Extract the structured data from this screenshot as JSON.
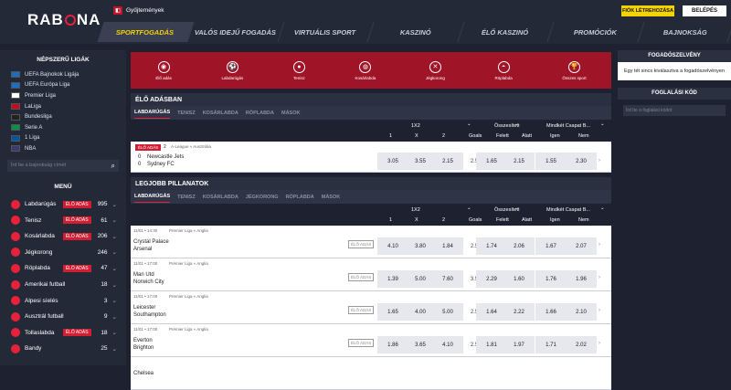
{
  "header": {
    "logo": "RABONA",
    "collections": "Gyűjtemények",
    "register": "FIÓK LÉTREHOZÁSA",
    "login": "BELÉPÉS",
    "nav": [
      "SPORTFOGADÁS",
      "VALÓS IDEJŰ FOGADÁS",
      "VIRTUÁLIS SPORT",
      "KASZINÓ",
      "ÉLŐ KASZINÓ",
      "PROMÓCIÓK",
      "BAJNOKSÁG"
    ]
  },
  "sidebar": {
    "popular_title": "NÉPSZERŰ LIGÁK",
    "leagues": [
      {
        "name": "UEFA Bajnokok Ligája",
        "flag": "#1a6fc4"
      },
      {
        "name": "UEFA Európa Liga",
        "flag": "#1a6fc4"
      },
      {
        "name": "Premier Liga",
        "flag": "#ffffff"
      },
      {
        "name": "LaLiga",
        "flag": "#c60b1e"
      },
      {
        "name": "Bundesliga",
        "flag": "#222222"
      },
      {
        "name": "Serie A",
        "flag": "#009246"
      },
      {
        "name": "1 Liga",
        "flag": "#0055a4"
      },
      {
        "name": "NBA",
        "flag": "#3c3b6e"
      }
    ],
    "search_placeholder": "Írd be a bajnokság címét",
    "menu_title": "MENÜ",
    "live_badge": "ÉLŐ ADÁS",
    "menu": [
      {
        "label": "Labdarúgás",
        "live": true,
        "count": "995"
      },
      {
        "label": "Tenisz",
        "live": true,
        "count": "61"
      },
      {
        "label": "Kosárlabda",
        "live": true,
        "count": "206"
      },
      {
        "label": "Jégkorong",
        "live": false,
        "count": "246"
      },
      {
        "label": "Röplabda",
        "live": true,
        "count": "47"
      },
      {
        "label": "Amerikai futball",
        "live": false,
        "count": "18"
      },
      {
        "label": "Alpesi síelés",
        "live": false,
        "count": "3"
      },
      {
        "label": "Ausztrál futball",
        "live": false,
        "count": "9"
      },
      {
        "label": "Tollaslabda",
        "live": true,
        "count": "18"
      },
      {
        "label": "Bandy",
        "live": false,
        "count": "25"
      }
    ]
  },
  "sports_bar": [
    "Élő adás",
    "Labdarúgás",
    "Tenisz",
    "Kosárlabda",
    "Jégkorong",
    "Röplabda",
    "Összes sport"
  ],
  "live": {
    "title": "ÉLŐ ADÁSBAN",
    "tabs": [
      "LABDARÚGÁS",
      "TENISZ",
      "KOSÁRLABDA",
      "RÖPLABDA",
      "MÁSOK"
    ],
    "headers": {
      "g1": "1X2",
      "g2": "Összesített",
      "g3": "Mindkét Csapat B...",
      "c": [
        "1",
        "X",
        "2",
        "Goals",
        "Felett",
        "Alatt",
        "Igen",
        "Nem"
      ]
    },
    "match": {
      "badge": "ÉLŐ ADÁS",
      "num": "2",
      "league": "A-League » Ausztrália",
      "s1": "0",
      "s2": "0",
      "home": "Newcastle Jets",
      "away": "Sydney FC",
      "odds": [
        "3.05",
        "3.55",
        "2.15",
        "2.5",
        "1.65",
        "2.15",
        "1.55",
        "2.30"
      ]
    }
  },
  "top": {
    "title": "LEGJOBB PILLANATOK",
    "tabs": [
      "LABDARÚGÁS",
      "TENISZ",
      "KOSÁRLABDA",
      "JÉGKORONG",
      "RÖPLABDA",
      "MÁSOK"
    ],
    "live_tag": "ÉLŐ ADÁS",
    "matches": [
      {
        "time": "11/01 • 14:30",
        "league": "Premier Liga » Anglia",
        "home": "Crystal Palace",
        "away": "Arsenal",
        "odds": [
          "4.10",
          "3.80",
          "1.84",
          "2.5",
          "1.74",
          "2.06",
          "1.67",
          "2.07"
        ]
      },
      {
        "time": "11/01 • 17:00",
        "league": "Premier Liga » Anglia",
        "home": "Man Utd",
        "away": "Norwich City",
        "odds": [
          "1.39",
          "5.00",
          "7.60",
          "3.5",
          "2.29",
          "1.60",
          "1.76",
          "1.96"
        ]
      },
      {
        "time": "11/01 • 17:00",
        "league": "Premier Liga » Anglia",
        "home": "Leicester",
        "away": "Southampton",
        "odds": [
          "1.65",
          "4.00",
          "5.00",
          "2.5",
          "1.64",
          "2.22",
          "1.66",
          "2.10"
        ]
      },
      {
        "time": "11/01 • 17:00",
        "league": "Premier Liga » Anglia",
        "home": "Everton",
        "away": "Brighton",
        "odds": [
          "1.86",
          "3.65",
          "4.10",
          "2.5",
          "1.81",
          "1.97",
          "1.71",
          "2.02"
        ]
      },
      {
        "time": "",
        "league": "",
        "home": "Chelsea",
        "away": "",
        "odds": [
          "",
          "",
          "",
          "",
          "",
          "",
          "",
          ""
        ]
      }
    ]
  },
  "right": {
    "betslip_title": "FOGADÓSZELVÉNY",
    "betslip_text": "Egy tét sincs kiválasztva a fogadószelvényen",
    "promo_title": "FOGLALÁSI KÓD",
    "promo_placeholder": "Írd be a foglalási kódot"
  },
  "colors": {
    "accent": "#e8213a",
    "nav_active": "#f5d300",
    "dark_bg": "#1e2230"
  }
}
